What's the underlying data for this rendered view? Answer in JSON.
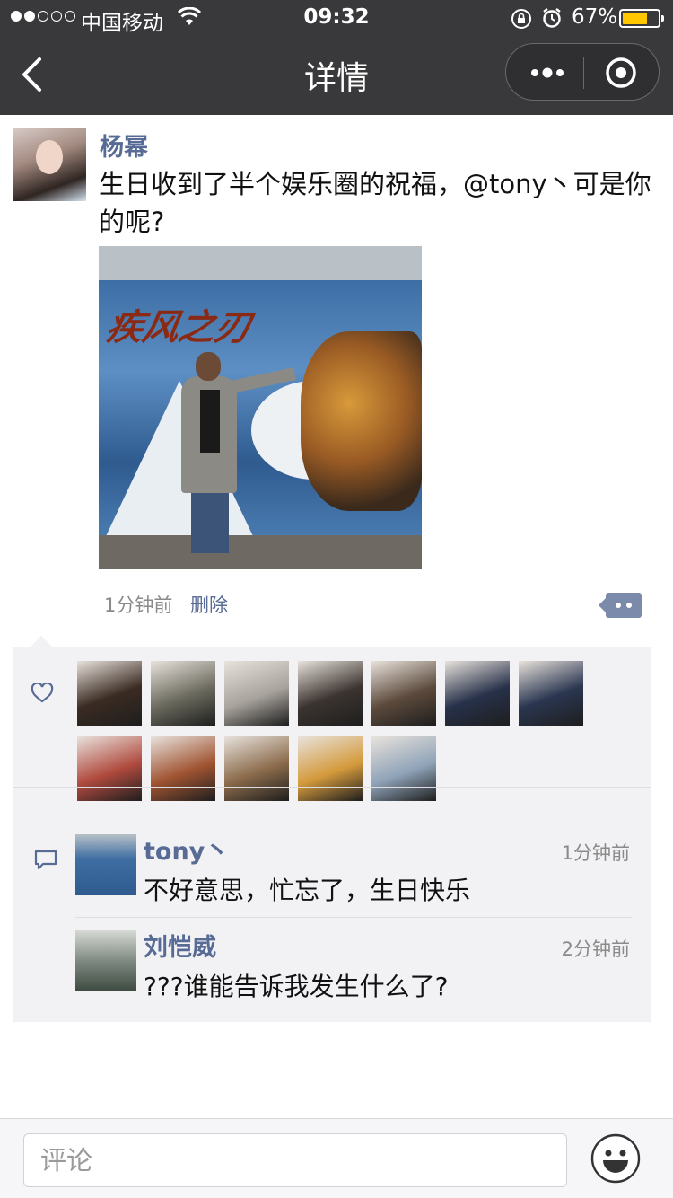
{
  "status_bar": {
    "carrier": "中国移动",
    "time": "09:32",
    "battery_percent": "67%",
    "battery_level": 0.67
  },
  "nav": {
    "title": "详情"
  },
  "post": {
    "author": "杨幂",
    "text": "生日收到了半个娱乐圈的祝福，@tony丶可是你的呢?",
    "image_caption": "疾风之刃",
    "time": "1分钟前",
    "delete_label": "删除"
  },
  "likers": [
    {
      "name": "liker-1",
      "color": "#3a2b22"
    },
    {
      "name": "liker-2",
      "color": "#6b6a5e"
    },
    {
      "name": "liker-3",
      "color": "#a7a29c"
    },
    {
      "name": "liker-4",
      "color": "#3b3430"
    },
    {
      "name": "liker-5",
      "color": "#5c4a3c"
    },
    {
      "name": "liker-6",
      "color": "#27314a"
    },
    {
      "name": "liker-7",
      "color": "#2a3650"
    },
    {
      "name": "liker-8",
      "color": "#b04a3e"
    },
    {
      "name": "liker-9",
      "color": "#a05432"
    },
    {
      "name": "liker-10",
      "color": "#8a6a4a"
    },
    {
      "name": "liker-11",
      "color": "#d49a3c"
    },
    {
      "name": "liker-12",
      "color": "#8fa3b8"
    }
  ],
  "comments": [
    {
      "name": "tony丶",
      "time": "1分钟前",
      "text": "不好意思，忙忘了，生日快乐"
    },
    {
      "name": "刘恺威",
      "time": "2分钟前",
      "text": "???谁能告诉我发生什么了?"
    }
  ],
  "input": {
    "placeholder": "评论"
  },
  "colors": {
    "nav_bg": "#39393b",
    "link": "#576b95",
    "panel_bg": "#f2f2f4",
    "battery": "#ffc700"
  }
}
